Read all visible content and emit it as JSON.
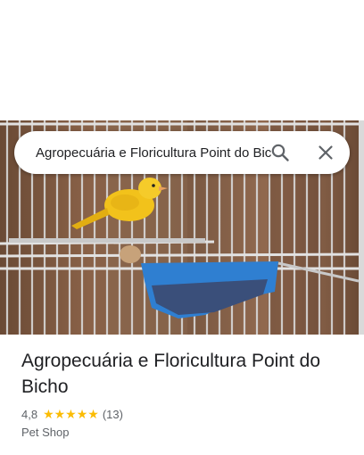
{
  "search": {
    "query": "Agropecuária e Floricultura Point do Bicho"
  },
  "place": {
    "name": "Agropecuária e Floricultura Point do Bicho",
    "rating": "4,8",
    "stars": "★★★★★",
    "rating_value": 4.8,
    "review_count": "(13)",
    "category": "Pet Shop"
  },
  "colors": {
    "star": "#fbbc04",
    "title_text": "#202124",
    "secondary_text": "#5f6368"
  },
  "icons": {
    "search": "search-icon",
    "close": "close-icon"
  }
}
